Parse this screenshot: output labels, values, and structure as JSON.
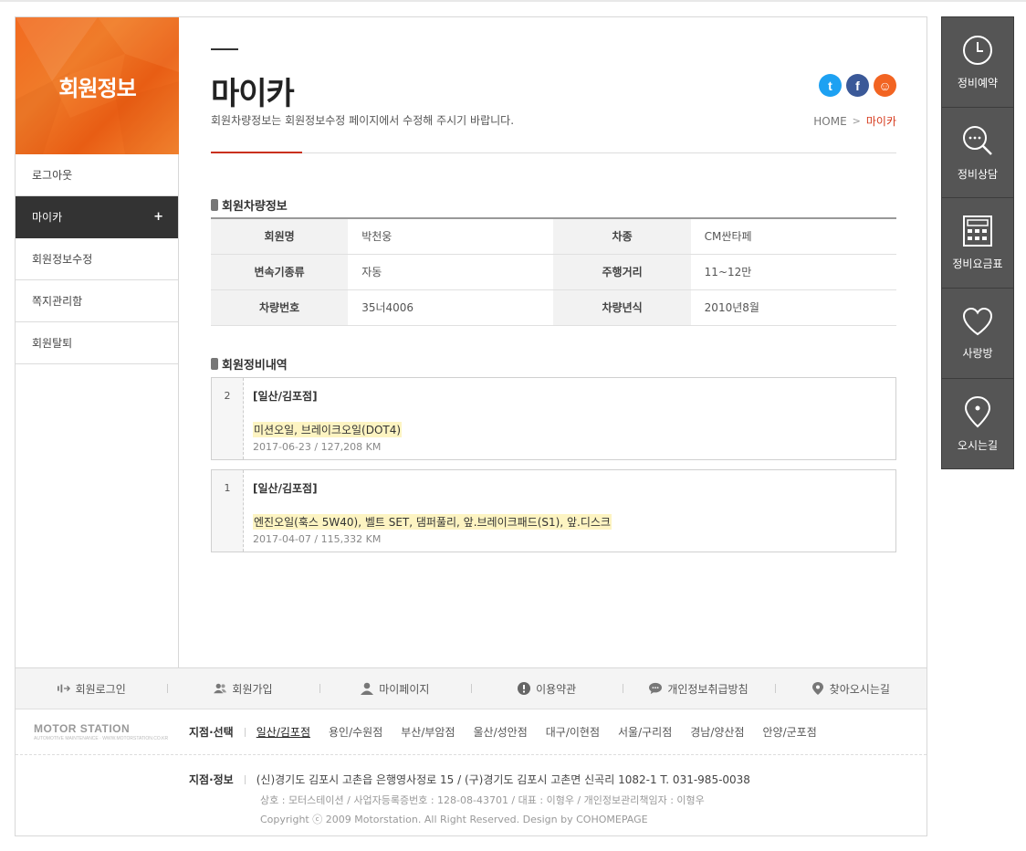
{
  "sidebar": {
    "title": "회원정보",
    "items": [
      {
        "label": "로그아웃",
        "active": false
      },
      {
        "label": "마이카",
        "active": true
      },
      {
        "label": "회원정보수정",
        "active": false
      },
      {
        "label": "쪽지관리함",
        "active": false
      },
      {
        "label": "회원탈퇴",
        "active": false
      }
    ],
    "active_plus": "+"
  },
  "header": {
    "title": "마이카",
    "description": "회원차량정보는 회원정보수정 페이지에서 수정해 주시기 바랍니다.",
    "breadcrumb": {
      "home": "HOME",
      "separator": ">",
      "current": "마이카"
    },
    "sns": [
      {
        "name": "twitter-icon",
        "glyph": "t"
      },
      {
        "name": "facebook-icon",
        "glyph": "f"
      },
      {
        "name": "kakaostory-icon",
        "glyph": "☺"
      }
    ]
  },
  "vehicle": {
    "section_title": "회원차량정보",
    "rows": [
      [
        {
          "th": "회원명",
          "td": "박천웅"
        },
        {
          "th": "차종",
          "td": "CM싼타페"
        }
      ],
      [
        {
          "th": "변속기종류",
          "td": "자동"
        },
        {
          "th": "주행거리",
          "td": "11~12만"
        }
      ],
      [
        {
          "th": "차량번호",
          "td": "35너4006"
        },
        {
          "th": "차량년식",
          "td": "2010년8월"
        }
      ]
    ]
  },
  "history": {
    "section_title": "회원정비내역",
    "entries": [
      {
        "no": "2",
        "branch": "[일산/김포점]",
        "items": "미션오일, 브레이크오일(DOT4)",
        "meta": "2017-06-23 / 127,208 KM"
      },
      {
        "no": "1",
        "branch": "[일산/김포점]",
        "items": "엔진오일(훅스 5W40), 벨트 SET, 댐퍼풀리, 앞.브레이크패드(S1), 앞.디스크",
        "meta": "2017-04-07 / 115,332 KM"
      }
    ]
  },
  "footer": {
    "nav": [
      {
        "label": "회원로그인",
        "icon": "login-icon"
      },
      {
        "label": "회원가입",
        "icon": "users-icon"
      },
      {
        "label": "마이페이지",
        "icon": "user-icon"
      },
      {
        "label": "이용약관",
        "icon": "alert-icon"
      },
      {
        "label": "개인정보취급방침",
        "icon": "chat-icon"
      },
      {
        "label": "찾아오시는길",
        "icon": "pin-icon"
      }
    ],
    "logo": {
      "text": "MOTOR STATION",
      "tagline": "AUTOMOTIVE MAINTENANCE · WWW.MOTORSTATION.CO.KR"
    },
    "branch_label": "지점·선택",
    "branches": [
      "일산/김포점",
      "용인/수원점",
      "부산/부암점",
      "울산/성안점",
      "대구/이현점",
      "서울/구리점",
      "경남/양산점",
      "안양/군포점"
    ],
    "info_label": "지점·정보",
    "address": "(신)경기도 김포시 고촌읍 은행영사정로 15 / (구)경기도 김포시 고촌면 신곡리 1082-1 T. 031-985-0038",
    "company": "상호 : 모터스테이션 / 사업자등록증번호 : 128-08-43701 / 대표 : 이형우 / 개인정보관리책임자 : 이형우",
    "copyright": "Copyright ⓒ 2009 Motorstation. All Right Reserved. Design by COHOMEPAGE"
  },
  "quick_menu": [
    {
      "label": "정비예약",
      "icon": "clock-icon"
    },
    {
      "label": "정비상담",
      "icon": "search-chat-icon"
    },
    {
      "label": "정비요금표",
      "icon": "calculator-icon"
    },
    {
      "label": "사랑방",
      "icon": "heart-icon"
    },
    {
      "label": "오시는길",
      "icon": "location-icon"
    }
  ],
  "colors": {
    "accent": "#c9301a",
    "brand_orange": "#f26a1f",
    "dark": "#333333",
    "quick_bg": "#555555",
    "highlight": "#fdf4c2"
  }
}
